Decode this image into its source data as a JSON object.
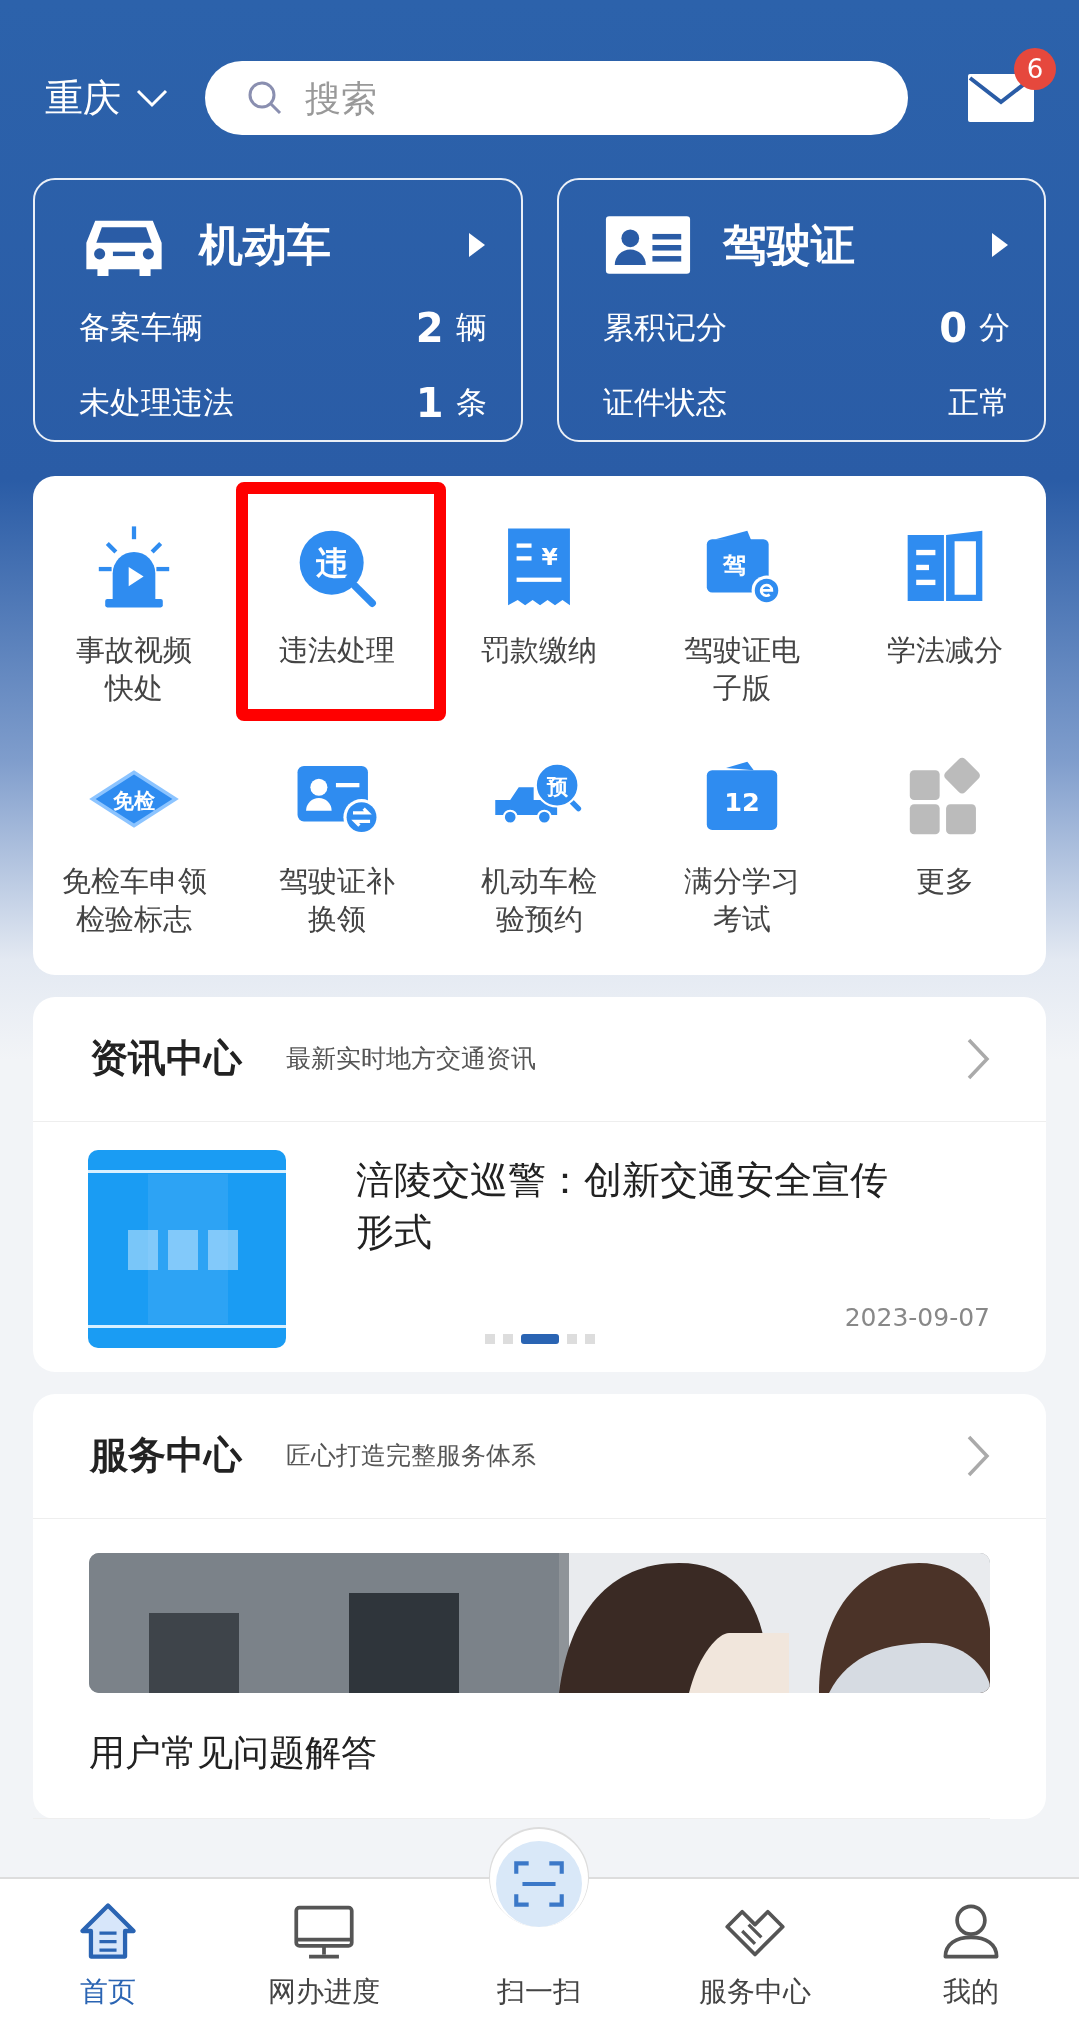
{
  "location": {
    "city": "重庆"
  },
  "search": {
    "placeholder": "搜索"
  },
  "messages": {
    "badge": "6"
  },
  "summary_cards": [
    {
      "kind": "car",
      "title": "机动车",
      "rows": [
        {
          "label": "备案车辆",
          "value": "2",
          "unit": "辆"
        },
        {
          "label": "未处理违法",
          "value": "1",
          "unit": "条"
        }
      ]
    },
    {
      "kind": "license",
      "title": "驾驶证",
      "rows": [
        {
          "label": "累积记分",
          "value": "0",
          "unit": "分"
        },
        {
          "label": "证件状态",
          "value": "正常"
        }
      ]
    }
  ],
  "services": [
    {
      "kind": "alarm",
      "label_lines": [
        "事故视频",
        "快处"
      ],
      "highlighted": false
    },
    {
      "kind": "violation",
      "icon_text": "违",
      "label_lines": [
        "违法处理"
      ],
      "highlighted": true
    },
    {
      "kind": "receipt",
      "icon_text": "¥",
      "label_lines": [
        "罚款缴纳"
      ],
      "highlighted": false
    },
    {
      "kind": "elicense",
      "icon_text": "驾",
      "label_lines": [
        "驾驶证电",
        "子版"
      ],
      "highlighted": false
    },
    {
      "kind": "book",
      "label_lines": [
        "学法减分"
      ],
      "highlighted": false
    },
    {
      "kind": "diamond",
      "icon_text": "免检",
      "label_lines": [
        "免检车申领",
        "检验标志"
      ],
      "highlighted": false
    },
    {
      "kind": "idswap",
      "label_lines": [
        "驾驶证补",
        "换领"
      ],
      "highlighted": false
    },
    {
      "kind": "truck",
      "icon_text": "预",
      "label_lines": [
        "机动车检",
        "验预约"
      ],
      "highlighted": false
    },
    {
      "kind": "calendar",
      "icon_text": "12",
      "label_lines": [
        "满分学习",
        "考试"
      ],
      "highlighted": false
    },
    {
      "kind": "more",
      "label_lines": [
        "更多"
      ],
      "highlighted": false
    }
  ],
  "news": {
    "title": "资讯中心",
    "subtitle": "最新实时地方交通资讯",
    "item": {
      "kind": "picture",
      "headline": "涪陵交巡警：创新交通安全宣传形式",
      "date": "2023-09-07"
    },
    "pager": [
      {
        "selected": false
      },
      {
        "selected": false
      },
      {
        "selected": true
      },
      {
        "selected": false
      },
      {
        "selected": false
      }
    ]
  },
  "service_center": {
    "title": "服务中心",
    "subtitle": "匠心打造完整服务体系",
    "faq_title": "用户常见问题解答"
  },
  "bottom_nav": [
    {
      "kind": "home",
      "label": "首页",
      "selected": true
    },
    {
      "kind": "monitor",
      "label": "网办进度",
      "selected": false
    },
    {
      "kind": "scan",
      "label": "扫一扫",
      "selected": false
    },
    {
      "kind": "handshake",
      "label": "服务中心",
      "selected": false
    },
    {
      "kind": "person",
      "label": "我的",
      "selected": false
    }
  ]
}
